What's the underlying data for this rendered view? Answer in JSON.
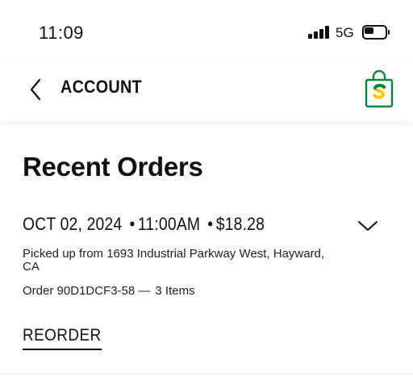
{
  "status_bar": {
    "time": "11:09",
    "network": "5G",
    "battery_level": 0.45
  },
  "nav": {
    "back_icon": "chevron-left-icon",
    "title": "ACCOUNT",
    "bag_icon": "subway-bag-icon",
    "brand_colors": {
      "green": "#008938",
      "yellow": "#FFC600"
    }
  },
  "page": {
    "title": "Recent Orders"
  },
  "orders": [
    {
      "date": "OCT 02, 2024",
      "time": "11:00AM",
      "total": "$18.28",
      "pickup": "Picked up from 1693 Industrial Parkway West, Hayward, CA",
      "order_id": "Order 90D1DCF3-58 —",
      "items": "3 Items",
      "reorder_label": "REORDER",
      "expand_icon": "chevron-down-icon"
    }
  ]
}
